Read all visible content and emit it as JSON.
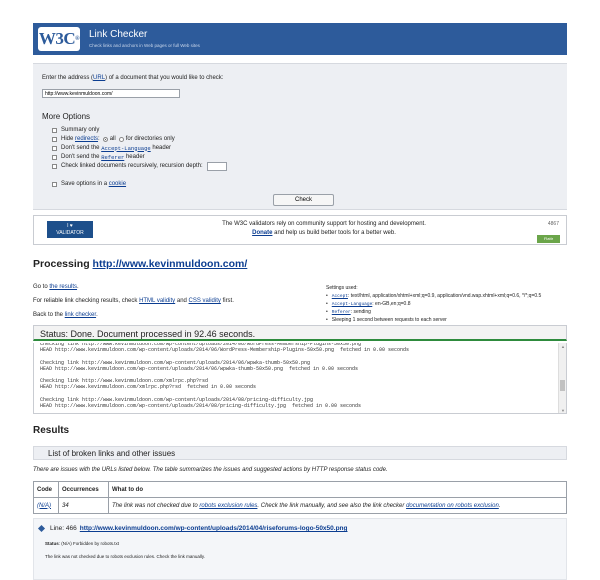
{
  "header": {
    "logo": "W3C",
    "logo_reg": "®",
    "title": "Link Checker",
    "subtitle": "Check links and anchors in Web pages or full Web sites"
  },
  "form": {
    "enter_prefix": "Enter the address (",
    "enter_link": "URL",
    "enter_suffix": ") of a document that you would like to check:",
    "uri_value": "http://www.kevinmuldoon.com/",
    "more_options": "More Options",
    "summary_only": "Summary only",
    "hide_prefix": "Hide",
    "hide_link": "redirects",
    "hide_suffix": ":",
    "all": "all",
    "for_directories": "for directories only",
    "dont_send": "Don't send the",
    "accept_language": "Accept-Language",
    "header_word": "header",
    "referer": "Referer",
    "check_recursive": "Check linked documents recursively, recursion depth:",
    "save_prefix": "Save options in a",
    "save_link": "cookie",
    "check_button": "Check"
  },
  "banner": {
    "badge_line1": "I ♥",
    "badge_line2": "VALIDATOR",
    "line1": "The W3C validators rely on community support for hosting and development.",
    "donate": "Donate",
    "line2": "and help us build better tools for a better web.",
    "count": "4867",
    "flattr": "Flattr"
  },
  "processing": {
    "label": "Processing",
    "url": "http://www.kevinmuldoon.com/"
  },
  "side": {
    "goto_prefix": "Go to",
    "goto_link": "the results",
    "reliable_prefix": "For reliable link checking results, check",
    "html_validity": "HTML validity",
    "and": "and",
    "css_validity": "CSS validity",
    "first": "first.",
    "back_prefix": "Back to the",
    "back_link": "link checker"
  },
  "settings": {
    "title": "Settings used:",
    "accept_label": "Accept",
    "accept_value": ": text/html, application/xhtml+xml;q=0.9, application/vnd.wap.xhtml+xml;q=0.6, */*;q=0.5",
    "accept_lang_label": "Accept-Language",
    "accept_lang_value": ": en-GB,en;q=0.8",
    "referer_label": "Referer",
    "referer_value": ": sending",
    "sleeping": "Sleeping 1 second between requests to each server"
  },
  "status": {
    "text": "Status: Done. Document processed in 92.46 seconds."
  },
  "log": {
    "lines": [
      "Checking link http://www.kevinmuldoon.com/wp-content/uploads/2014/06/WordPress-Membership-Plugins-50x50.png",
      "HEAD http://www.kevinmuldoon.com/wp-content/uploads/2014/06/WordPress-Membership-Plugins-50x50.png  fetched in 0.00 seconds",
      "",
      "Checking link http://www.kevinmuldoon.com/wp-content/uploads/2014/06/wpwka-thumb-50x50.png",
      "HEAD http://www.kevinmuldoon.com/wp-content/uploads/2014/06/wpwka-thumb-50x50.png  fetched in 0.00 seconds",
      "",
      "Checking link http://www.kevinmuldoon.com/xmlrpc.php?rsd",
      "HEAD http://www.kevinmuldoon.com/xmlrpc.php?rsd  fetched in 0.00 seconds",
      "",
      "Checking link http://www.kevinmuldoon.com/wp-content/uploads/2014/08/pricing-difficulty.jpg",
      "HEAD http://www.kevinmuldoon.com/wp-content/uploads/2014/08/pricing-difficulty.jpg  fetched in 0.00 seconds",
      "",
      "Checking link http://www.kevinmuldoon.com/category/scripts-applications-services/",
      "HEAD http://www.kevinmuldoon.com/category/scripts-applications-services/  fetched in 1.22 seconds"
    ]
  },
  "results": {
    "heading": "Results",
    "broken_heading": "List of broken links and other issues",
    "issues_text": "There are issues with the URLs listed below. The table summarizes the issues and suggested actions by HTTP response status code.",
    "table": {
      "headers": [
        "Code",
        "Occurrences",
        "What to do"
      ],
      "row": {
        "code": "(N/A)",
        "occurrences": "34",
        "what_prefix": "The link was not checked due to",
        "what_link1": "robots exclusion rules",
        "what_middle": ". Check the link manually, and see also the link checker",
        "what_link2": "documentation on robots exclusion",
        "what_suffix": "."
      }
    },
    "line_label": "Line: 466",
    "line_url": "http://www.kevinmuldoon.com/wp-content/uploads/2014/04/riseforums-logo-50x50.png",
    "status_label": "Status",
    "status_value": ": (N/A) Forbidden by robots.txt",
    "not_checked": "The link was not checked due to robots exclusion rules. Check the link manually."
  },
  "colors": {
    "header_blue": "#2d5b9b",
    "form_bg": "#edeff3",
    "status_green": "#2e8b3d",
    "link": "#0b3d91"
  }
}
